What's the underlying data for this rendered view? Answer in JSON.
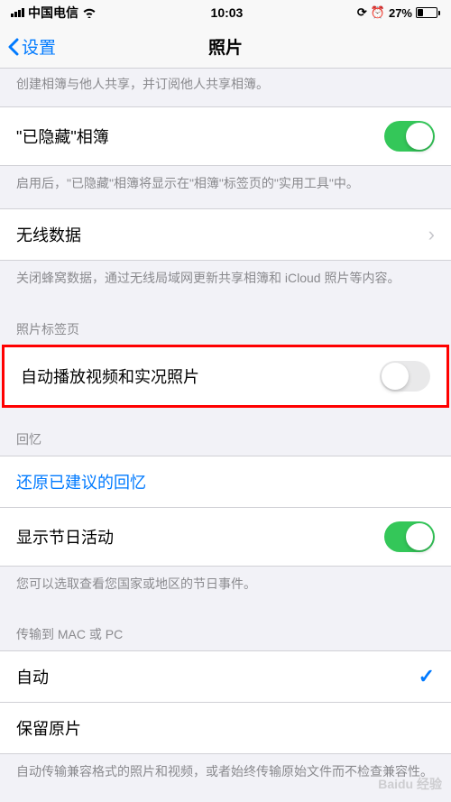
{
  "status": {
    "carrier": "中国电信",
    "time": "10:03",
    "battery_pct": "27%"
  },
  "nav": {
    "back": "设置",
    "title": "照片"
  },
  "top_footer": "创建相簿与他人共享，并订阅他人共享相簿。",
  "hidden_album": {
    "label": "\"已隐藏\"相簿",
    "footer": "启用后，\"已隐藏\"相簿将显示在\"相簿\"标签页的\"实用工具\"中。",
    "on": true
  },
  "wireless": {
    "label": "无线数据",
    "footer": "关闭蜂窝数据，通过无线局域网更新共享相簿和 iCloud 照片等内容。"
  },
  "photos_tab": {
    "header": "照片标签页",
    "autoplay_label": "自动播放视频和实况照片",
    "autoplay_on": false
  },
  "memories": {
    "header": "回忆",
    "reset_label": "还原已建议的回忆",
    "holiday_label": "显示节日活动",
    "holiday_on": true,
    "footer": "您可以选取查看您国家或地区的节日事件。"
  },
  "transfer": {
    "header": "传输到 MAC 或 PC",
    "auto_label": "自动",
    "original_label": "保留原片",
    "footer": "自动传输兼容格式的照片和视频，或者始终传输原始文件而不检查兼容性。"
  },
  "watermark": "Baidu 经验"
}
